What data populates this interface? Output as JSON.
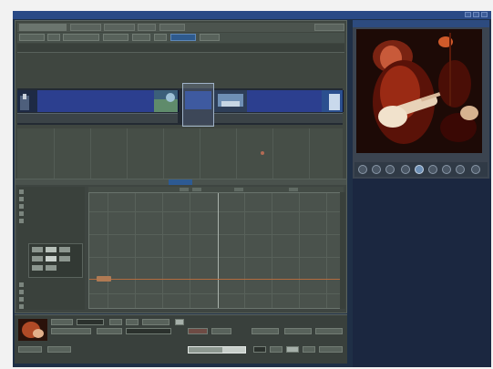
{
  "window": {
    "title": ""
  },
  "colors": {
    "titlebar": "#2a4a86",
    "panel": "#3f4640",
    "clip_blue": "#2c3f8f",
    "accent_blue": "#2d5a93",
    "keyframe_orange": "#b36b3e",
    "viewer_background": "#1b2740"
  },
  "timeline": {
    "tabs": [
      "",
      "",
      "",
      "",
      "",
      ""
    ],
    "tools": [
      "",
      "",
      "",
      "",
      "",
      "",
      "",
      ""
    ],
    "clips": [
      {
        "label": "",
        "strip_label": ""
      },
      {
        "label": "",
        "strip_label": ""
      },
      {
        "label": "",
        "strip_label": ""
      }
    ]
  },
  "viewer": {
    "title": "",
    "timecode": "",
    "transport_icons": [
      "rewind-to-start-icon",
      "step-back-icon",
      "play-reverse-icon",
      "stop-icon",
      "play-icon",
      "step-forward-icon",
      "fast-forward-icon",
      "go-to-end-icon",
      "loop-icon"
    ]
  },
  "effect_editor": {
    "tab_label": "",
    "parameters": [
      {
        "name": "",
        "value": ""
      },
      {
        "name": "",
        "value": ""
      },
      {
        "name": "",
        "value": ""
      },
      {
        "name": "",
        "value": ""
      },
      {
        "name": "",
        "value": ""
      },
      {
        "name": "",
        "value": ""
      },
      {
        "name": "",
        "value": ""
      },
      {
        "name": "",
        "value": ""
      },
      {
        "name": "",
        "value": ""
      },
      {
        "name": "",
        "value": ""
      },
      {
        "name": "",
        "value": ""
      }
    ]
  },
  "bottom_strip": {
    "labels": [
      "",
      "",
      "",
      ""
    ],
    "meter_level": 0.6
  }
}
